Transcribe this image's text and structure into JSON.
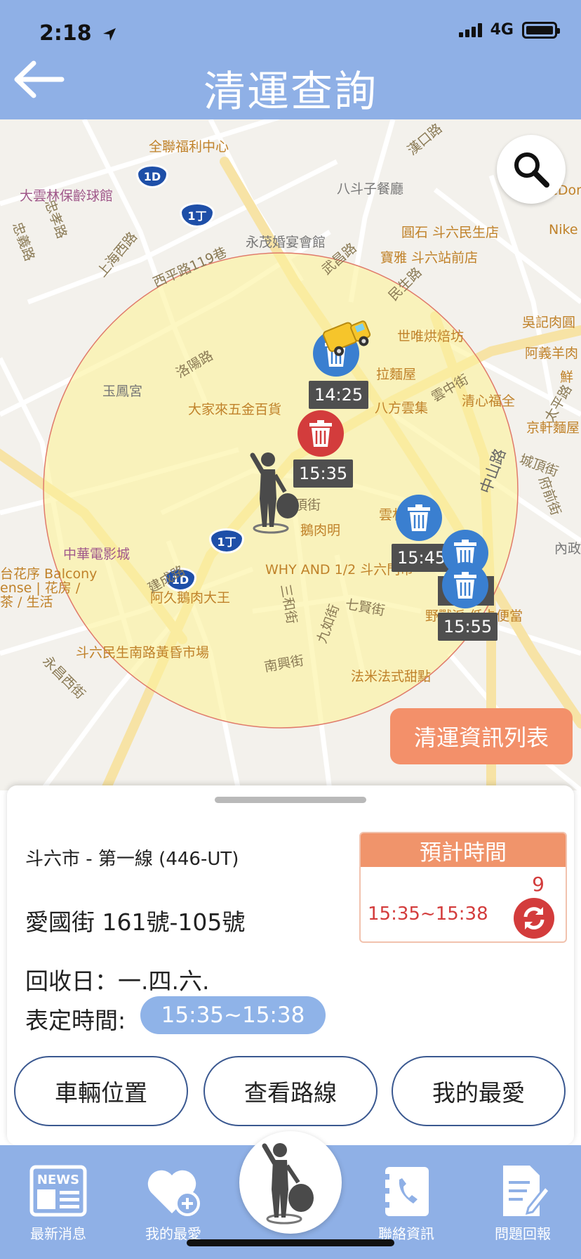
{
  "status_bar": {
    "time": "2:18",
    "network": "4G"
  },
  "header": {
    "title": "清運查詢"
  },
  "map": {
    "labels": {
      "l1": "全聯福利中心",
      "l2": "大雲林保齡球館",
      "l3": "八斗子餐廳",
      "l4": "永茂婚宴會館",
      "l5": "圓石 斗六民生店",
      "l6": "寶雅 斗六站前店",
      "l7": "世唯烘焙坊",
      "l8": "吳記肉圓",
      "l9": "阿義羊肉",
      "l10": "鮮",
      "l11": "玉鳳宮",
      "l12": "八方雲集",
      "l13": "清心福全",
      "l14": "大家來五金百貨",
      "l15": "京軒麵屋",
      "l16": "雲林溪美",
      "l17": "鵝肉明",
      "l18": "中華電影城",
      "l19": "WHY AND 1/2 斗六門市",
      "l20": "阿久鵝肉大王",
      "l21": "野獸派 低卡便當",
      "l22": "斗六民生南路黃昏市場",
      "l23": "法米法式甜點",
      "l24": "內政",
      "l25": "McDon",
      "l26": "Nike",
      "l27": "台花序 Balcony",
      "l28": "ense | 花房 /",
      "l29": "茶 / 生活",
      "l30": "拉麵屋",
      "r1": "西平路119巷",
      "r2": "洛陽路",
      "r3": "上海西路",
      "r4": "武昌路",
      "r5": "民生路",
      "r6": "雲中街",
      "r7": "中山路",
      "r8": "城頂街",
      "r9": "建成路",
      "r10": "三和街",
      "r11": "九如街",
      "r12": "七賢街",
      "r13": "南興街",
      "r14": "永昌西街",
      "r15": "府前街",
      "r16": "太平路",
      "r17": "漢口路",
      "r18": "城頂街",
      "r19": "忠孝路",
      "r20": "忠義路"
    },
    "route_shields": [
      "1D",
      "1丁",
      "1丁",
      "1D"
    ],
    "time_labels": {
      "t1": "14:25",
      "t2": "15:35",
      "t3": "15:45",
      "t4": "15:55"
    },
    "list_button": "清運資訊列表",
    "search_icon": "search-icon"
  },
  "panel": {
    "route_name": "斗六市 - 第一線 (446-UT)",
    "address": "愛國街 161號-105號",
    "collect_days": "回收日：一.四.六.",
    "scheduled_label": "表定時間:",
    "scheduled_time": "15:35~15:38",
    "estimate_title": "預計時間",
    "estimate_count": "9",
    "estimate_time": "15:35~15:38",
    "buttons": {
      "vehicle": "車輛位置",
      "route": "查看路線",
      "favorite": "我的最愛"
    }
  },
  "tabbar": {
    "news": "最新消息",
    "favorites": "我的最愛",
    "contact": "聯絡資訊",
    "feedback": "問題回報",
    "news_badge": "NEWS"
  },
  "colors": {
    "header": "#8fb0e6",
    "accent": "#f0946b",
    "red": "#d33c3c",
    "blue_bin": "#3a7fd0"
  }
}
